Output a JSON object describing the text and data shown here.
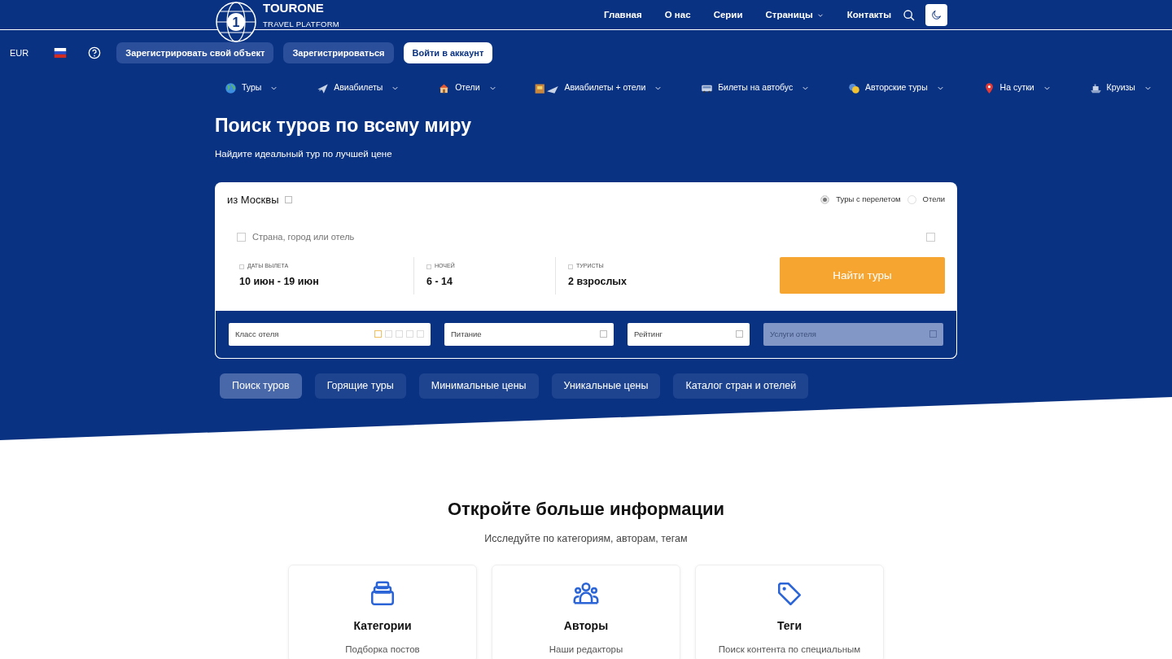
{
  "header": {
    "logo": {
      "mark": "1",
      "title": "TOURONE",
      "subtitle": "TRAVEL PLATFORM"
    },
    "nav": [
      {
        "label": "Главная",
        "dropdown": false
      },
      {
        "label": "О нас",
        "dropdown": false
      },
      {
        "label": "Серии",
        "dropdown": false
      },
      {
        "label": "Страницы",
        "dropdown": true
      },
      {
        "label": "Контакты",
        "dropdown": false
      }
    ]
  },
  "toolbar": {
    "currency": "EUR",
    "buttons": [
      {
        "label": "Зарегистрировать свой объект",
        "kind": "secondary"
      },
      {
        "label": "Зарегистрироваться",
        "kind": "secondary"
      },
      {
        "label": "Войти в аккаунт",
        "kind": "primary"
      }
    ]
  },
  "categories": [
    {
      "label": "Туры",
      "kind": "globe"
    },
    {
      "label": "Авиабилеты",
      "kind": "plane"
    },
    {
      "label": "Отели",
      "kind": "house"
    },
    {
      "label": "Авиабилеты + отели",
      "kind": "hotel-plane"
    },
    {
      "label": "Билеты на автобус",
      "kind": "bus"
    },
    {
      "label": "Авторские туры",
      "kind": "masks"
    },
    {
      "label": "На сутки",
      "kind": "pin"
    },
    {
      "label": "Круизы",
      "kind": "ship"
    }
  ],
  "hero": {
    "title": "Поиск туров по всему миру",
    "subtitle": "Найдите идеальный тур по лучшей цене"
  },
  "search": {
    "departure": "из Москвы",
    "modes": [
      {
        "label": "Туры с перелетом",
        "selected": true
      },
      {
        "label": "Отели",
        "selected": false
      }
    ],
    "destination": {
      "placeholder": "Страна, город или отель"
    },
    "fields": [
      {
        "label": "ДАТЫ ВЫЛЕТА",
        "value": "10 июн - 19 июн"
      },
      {
        "label": "НОЧЕЙ",
        "value": "6 - 14"
      },
      {
        "label": "ТУРИСТЫ",
        "value": "2 взрослых"
      }
    ],
    "submit": "Найти туры",
    "filters": [
      {
        "label": "Класс отеля",
        "kind": "stars",
        "disabled": false
      },
      {
        "label": "Питание",
        "kind": "select",
        "disabled": false
      },
      {
        "label": "Рейтинг",
        "kind": "select",
        "disabled": false
      },
      {
        "label": "Услуги отеля",
        "kind": "select",
        "disabled": true
      }
    ]
  },
  "tabs": [
    {
      "label": "Поиск туров",
      "selected": true
    },
    {
      "label": "Горящие туры",
      "selected": false
    },
    {
      "label": "Минимальные цены",
      "selected": false
    },
    {
      "label": "Уникальные цены",
      "selected": false
    },
    {
      "label": "Каталог стран и отелей",
      "selected": false
    }
  ],
  "section": {
    "title": "Откройте больше информации",
    "subtitle": "Исследуйте по категориям, авторам, тегам",
    "cards": [
      {
        "kind": "layers",
        "title": "Категории",
        "text": "Подборка постов"
      },
      {
        "kind": "people",
        "title": "Авторы",
        "text": "Наши редакторы"
      },
      {
        "kind": "tag",
        "title": "Теги",
        "text": "Поиск контента по специальным"
      }
    ]
  }
}
